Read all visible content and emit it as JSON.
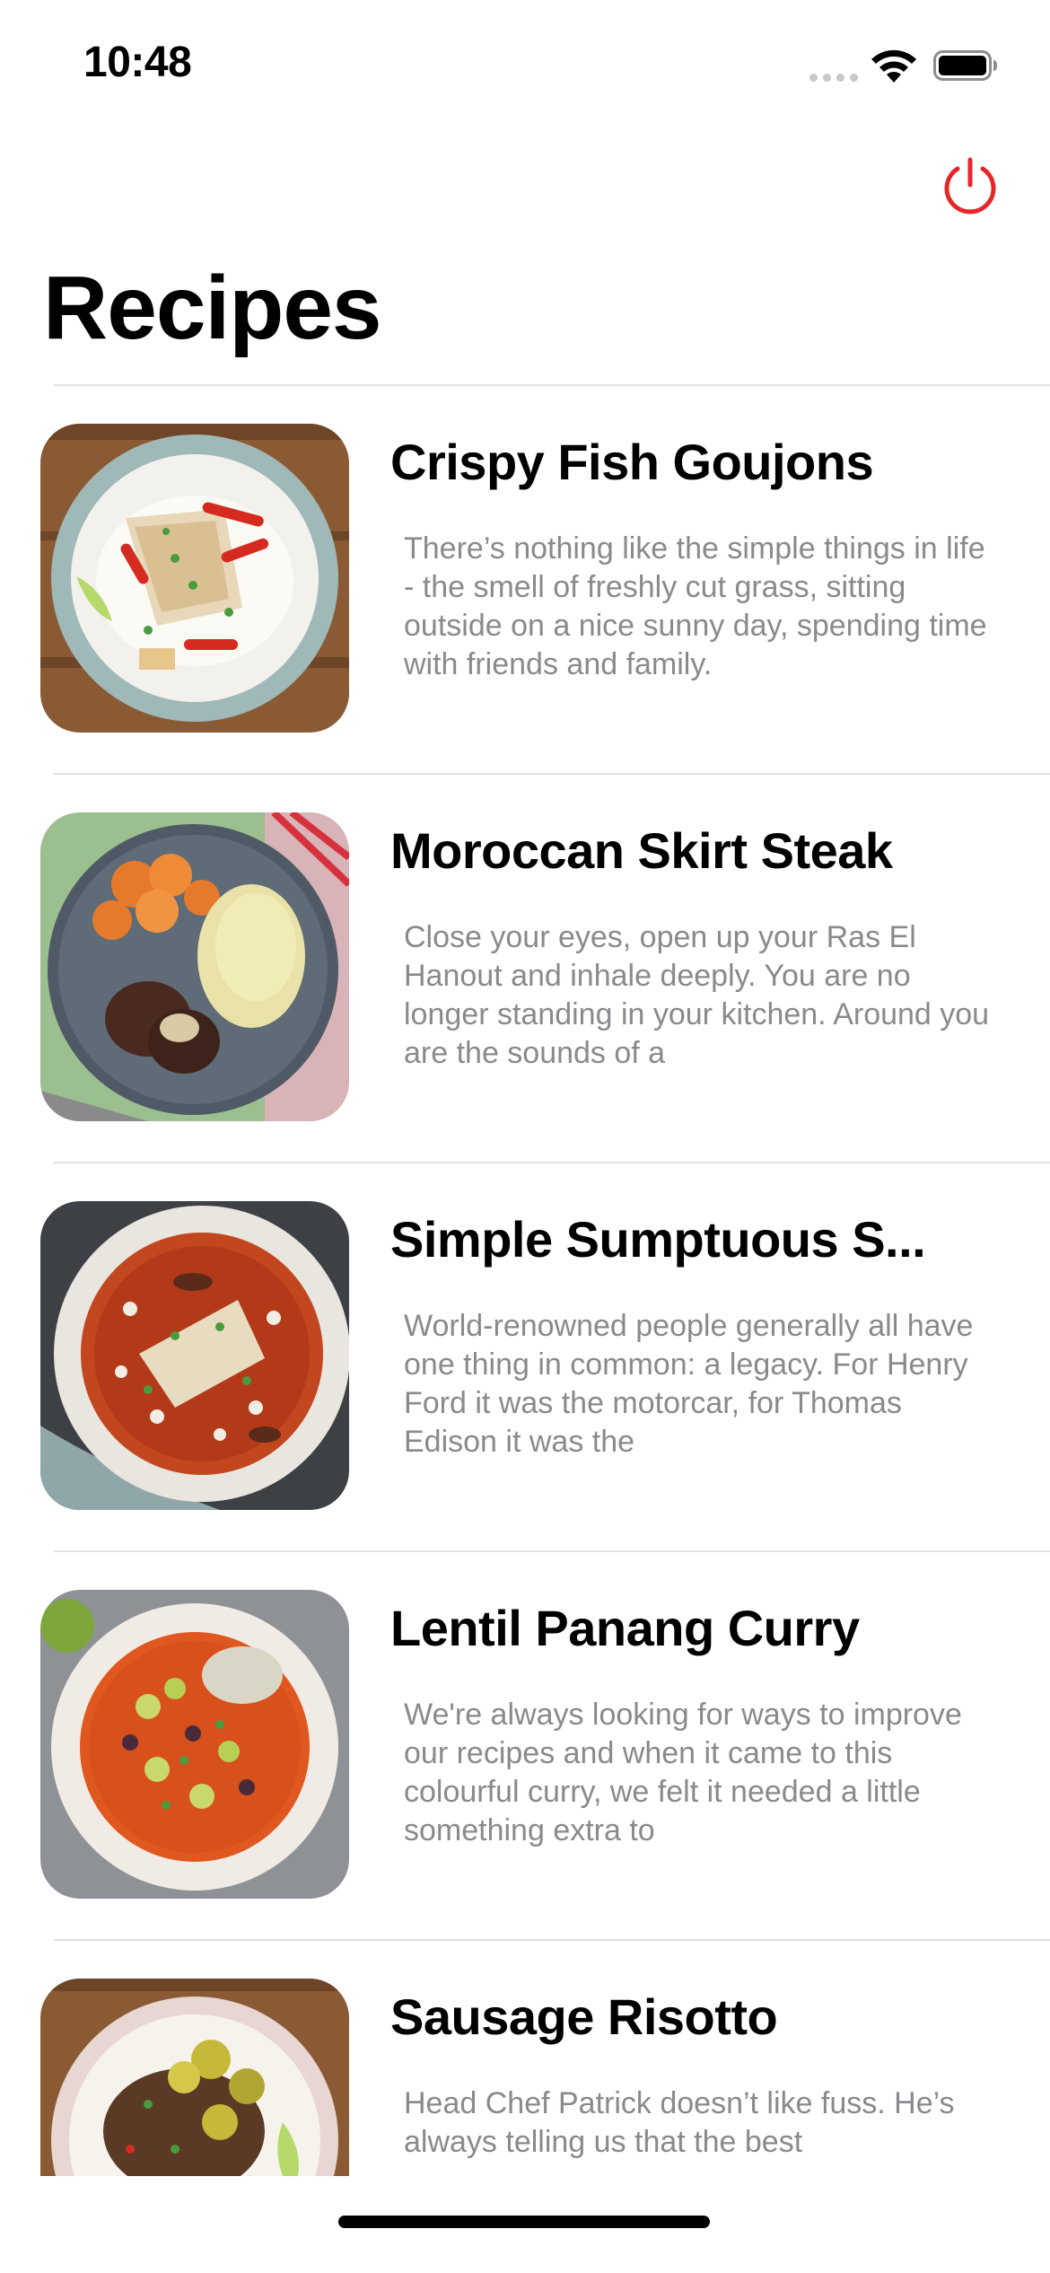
{
  "status_bar": {
    "time": "10:48",
    "signal_icon": "cellular-signal-icon",
    "wifi_icon": "wifi-icon",
    "battery_icon": "battery-icon"
  },
  "header": {
    "power_icon": "power-icon",
    "power_color": "#e5262a",
    "title": "Recipes"
  },
  "recipes": [
    {
      "title": "Crispy Fish Goujons",
      "description": "There’s nothing like the simple things in life - the smell of freshly cut grass, sitting outside on a nice sunny day, spending time with friends and family.",
      "image": "fish-goujons-plate-image"
    },
    {
      "title": "Moroccan Skirt Steak",
      "description": "Close your eyes, open up your Ras El Hanout and inhale deeply. You are no longer standing in your kitchen. Around you are the sounds of a",
      "image": "skirt-steak-plate-image"
    },
    {
      "title": "Simple Sumptuous S...",
      "description": "World-renowned people generally all have one thing in common: a legacy. For Henry Ford it was the motorcar, for Thomas Edison it was the",
      "image": "sumptuous-stew-bowl-image"
    },
    {
      "title": "Lentil Panang Curry",
      "description": "We're always looking for ways to improve our recipes and when it came to this colourful curry, we felt it needed a little something extra to",
      "image": "lentil-curry-bowl-image"
    },
    {
      "title": "Sausage Risotto",
      "description": "Head Chef Patrick doesn’t like fuss. He’s always telling us that the best",
      "image": "sausage-risotto-plate-image"
    }
  ]
}
